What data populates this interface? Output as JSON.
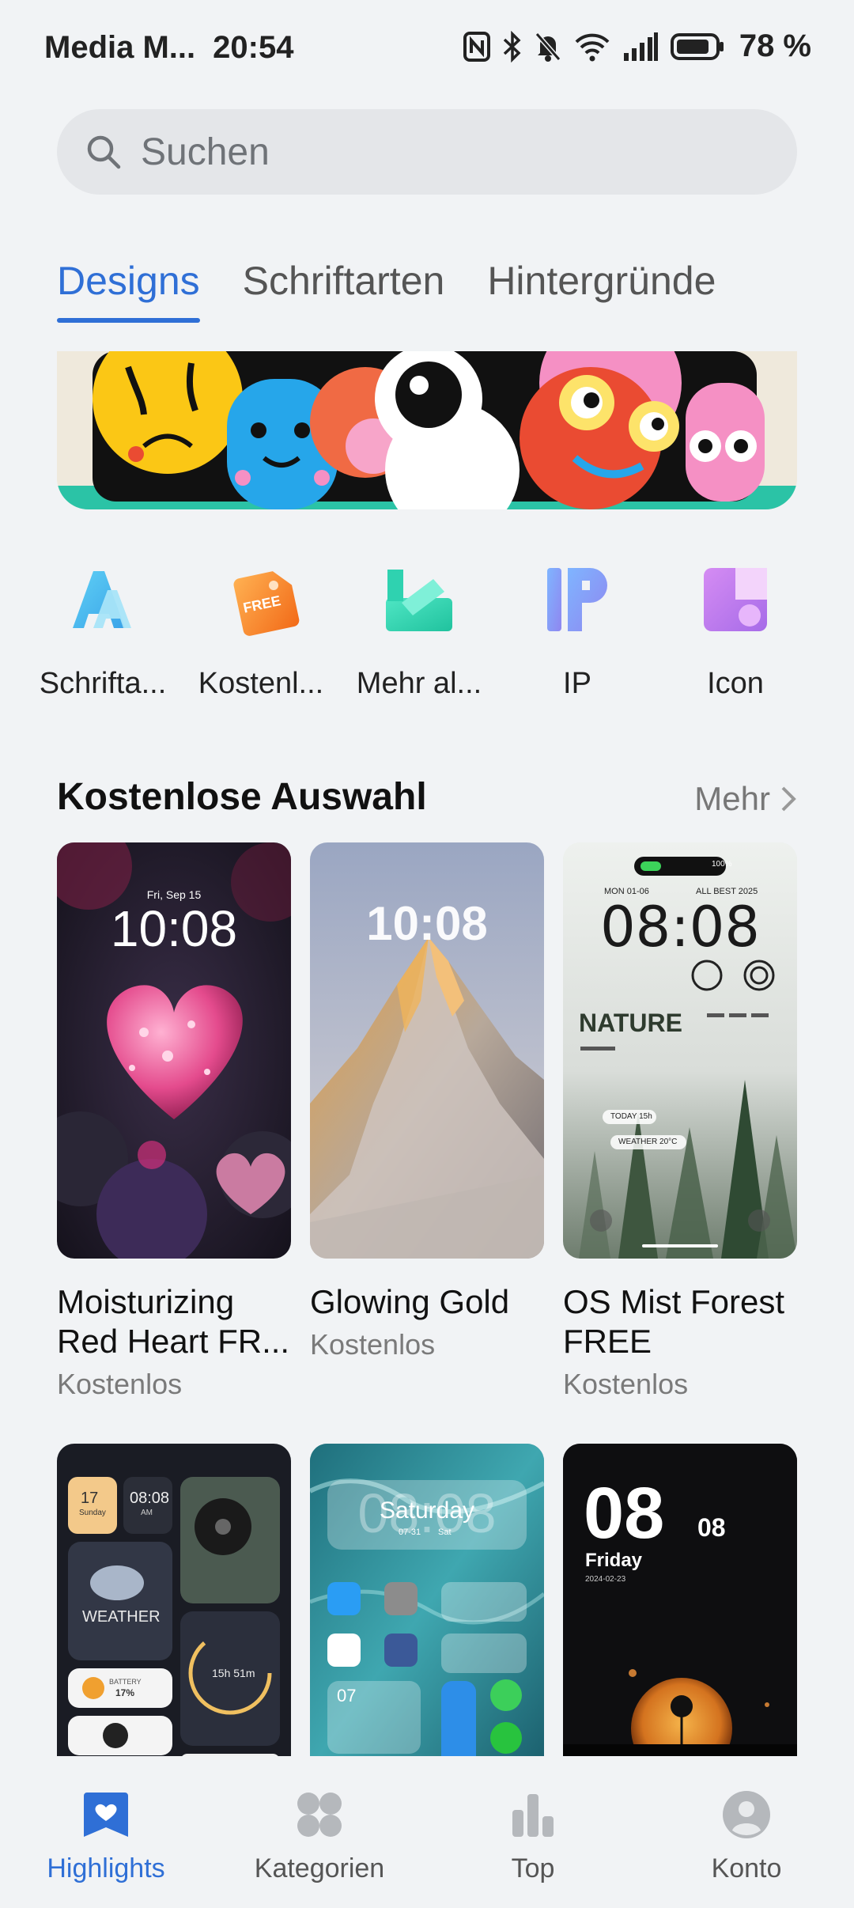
{
  "status_bar": {
    "carrier": "Media M...",
    "time": "20:54",
    "battery": "78 %",
    "icons": [
      "nfc-icon",
      "bluetooth-icon",
      "mute-icon",
      "wifi-icon",
      "signal-icon",
      "battery-icon"
    ]
  },
  "search": {
    "placeholder": "Suchen"
  },
  "tabs": [
    {
      "label": "Designs",
      "active": true
    },
    {
      "label": "Schriftarten",
      "active": false
    },
    {
      "label": "Hintergründe",
      "active": false
    }
  ],
  "quick_categories": [
    {
      "label": "Schrifta...",
      "icon": "font-icon"
    },
    {
      "label": "Kostenl...",
      "icon": "free-tag-icon"
    },
    {
      "label": "Mehr al...",
      "icon": "more-apps-icon"
    },
    {
      "label": "IP",
      "icon": "ip-icon"
    },
    {
      "label": "Icon",
      "icon": "icon-pack-icon"
    }
  ],
  "section": {
    "title": "Kostenlose Auswahl",
    "more": "Mehr"
  },
  "cards": [
    {
      "title": "Moisturizing Red Heart FR...",
      "price": "Kostenlos",
      "clock": "10:08",
      "date": "Fri, Sep 15"
    },
    {
      "title": "Glowing Gold",
      "price": "Kostenlos",
      "clock": "10:08"
    },
    {
      "title": "OS Mist Forest FREE",
      "price": "Kostenlos",
      "clock": "08:08",
      "date": "MON 01-06",
      "tag": "ALL BEST 2025",
      "battery": "100%",
      "label": "NATURE",
      "today": "TODAY 15h",
      "weather": "WEATHER 20°C"
    }
  ],
  "cards_row2": [
    {
      "date_num": "17",
      "date_day": "Sunday",
      "clock": "08:08",
      "ampm": "AM",
      "weather_label": "WEATHER",
      "battery_label": "BATTERY",
      "battery_value": "17%",
      "countdown": "15h 51m"
    },
    {
      "day": "Saturday",
      "date": "07-31",
      "weekday": "Sat",
      "clock": "08:08",
      "cal": "07"
    },
    {
      "clock": "08",
      "clock_small": "08",
      "day": "Friday",
      "date": "2024-02-23"
    }
  ],
  "bottom_nav": [
    {
      "label": "Highlights",
      "icon": "heart-icon",
      "active": true
    },
    {
      "label": "Kategorien",
      "icon": "grid-icon",
      "active": false
    },
    {
      "label": "Top",
      "icon": "bar-chart-icon",
      "active": false
    },
    {
      "label": "Konto",
      "icon": "account-icon",
      "active": false
    }
  ],
  "colors": {
    "accent": "#2f6fd6",
    "background": "#f1f3f5"
  }
}
